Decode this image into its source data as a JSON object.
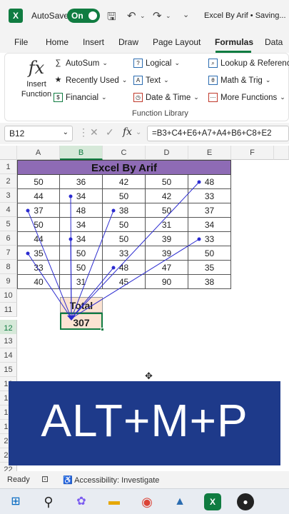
{
  "titlebar": {
    "app_icon": "X",
    "autosave_label": "AutoSave",
    "autosave_state": "On",
    "doc_title": "Excel By Arif • Saving...",
    "icons": [
      "save-icon",
      "undo-icon",
      "redo-icon",
      "more-icon"
    ]
  },
  "tabs": [
    "File",
    "Home",
    "Insert",
    "Draw",
    "Page Layout",
    "Formulas",
    "Data"
  ],
  "active_tab": "Formulas",
  "ribbon": {
    "insert_function_line1": "Insert",
    "insert_function_line2": "Function",
    "col1": [
      "AutoSum",
      "Recently Used",
      "Financial"
    ],
    "col2": [
      "Logical",
      "Text",
      "Date & Time"
    ],
    "col3": [
      "Lookup & Reference",
      "Math & Trig",
      "More Functions"
    ],
    "group_label": "Function Library"
  },
  "formula_bar": {
    "name_box": "B12",
    "formula": "=B3+C4+E6+A7+A4+B6+C8+E2"
  },
  "sheet": {
    "columns": [
      "A",
      "B",
      "C",
      "D",
      "E",
      "F"
    ],
    "rows": [
      "1",
      "2",
      "3",
      "4",
      "5",
      "6",
      "7",
      "8",
      "9",
      "10",
      "11",
      "12",
      "13",
      "14",
      "15",
      "16",
      "17",
      "18",
      "19",
      "20",
      "21",
      "22"
    ],
    "title": "Excel By Arif",
    "data": [
      [
        "50",
        "36",
        "42",
        "50",
        "48"
      ],
      [
        "44",
        "34",
        "50",
        "42",
        "33"
      ],
      [
        "37",
        "48",
        "38",
        "50",
        "37"
      ],
      [
        "50",
        "34",
        "50",
        "31",
        "34"
      ],
      [
        "44",
        "34",
        "50",
        "39",
        "33"
      ],
      [
        "35",
        "50",
        "33",
        "39",
        "50"
      ],
      [
        "33",
        "50",
        "48",
        "47",
        "35"
      ],
      [
        "40",
        "31",
        "45",
        "90",
        "38"
      ]
    ],
    "total_label": "Total",
    "total_value": "307"
  },
  "overlay_text": "ALT+M+P",
  "statusbar": {
    "ready": "Ready",
    "accessibility": "Accessibility: Investigate"
  },
  "taskbar_icons": [
    "windows-icon",
    "search-icon",
    "copilot-icon",
    "file-explorer-icon",
    "chrome-icon",
    "photos-icon",
    "excel-icon",
    "obs-icon"
  ],
  "colors": {
    "excel_green": "#107c41",
    "title_purple": "#8e6bb5",
    "total_fill": "#fbe3d2",
    "banner_blue": "#1e3a8a",
    "arrow_blue": "#2b2bd0"
  }
}
